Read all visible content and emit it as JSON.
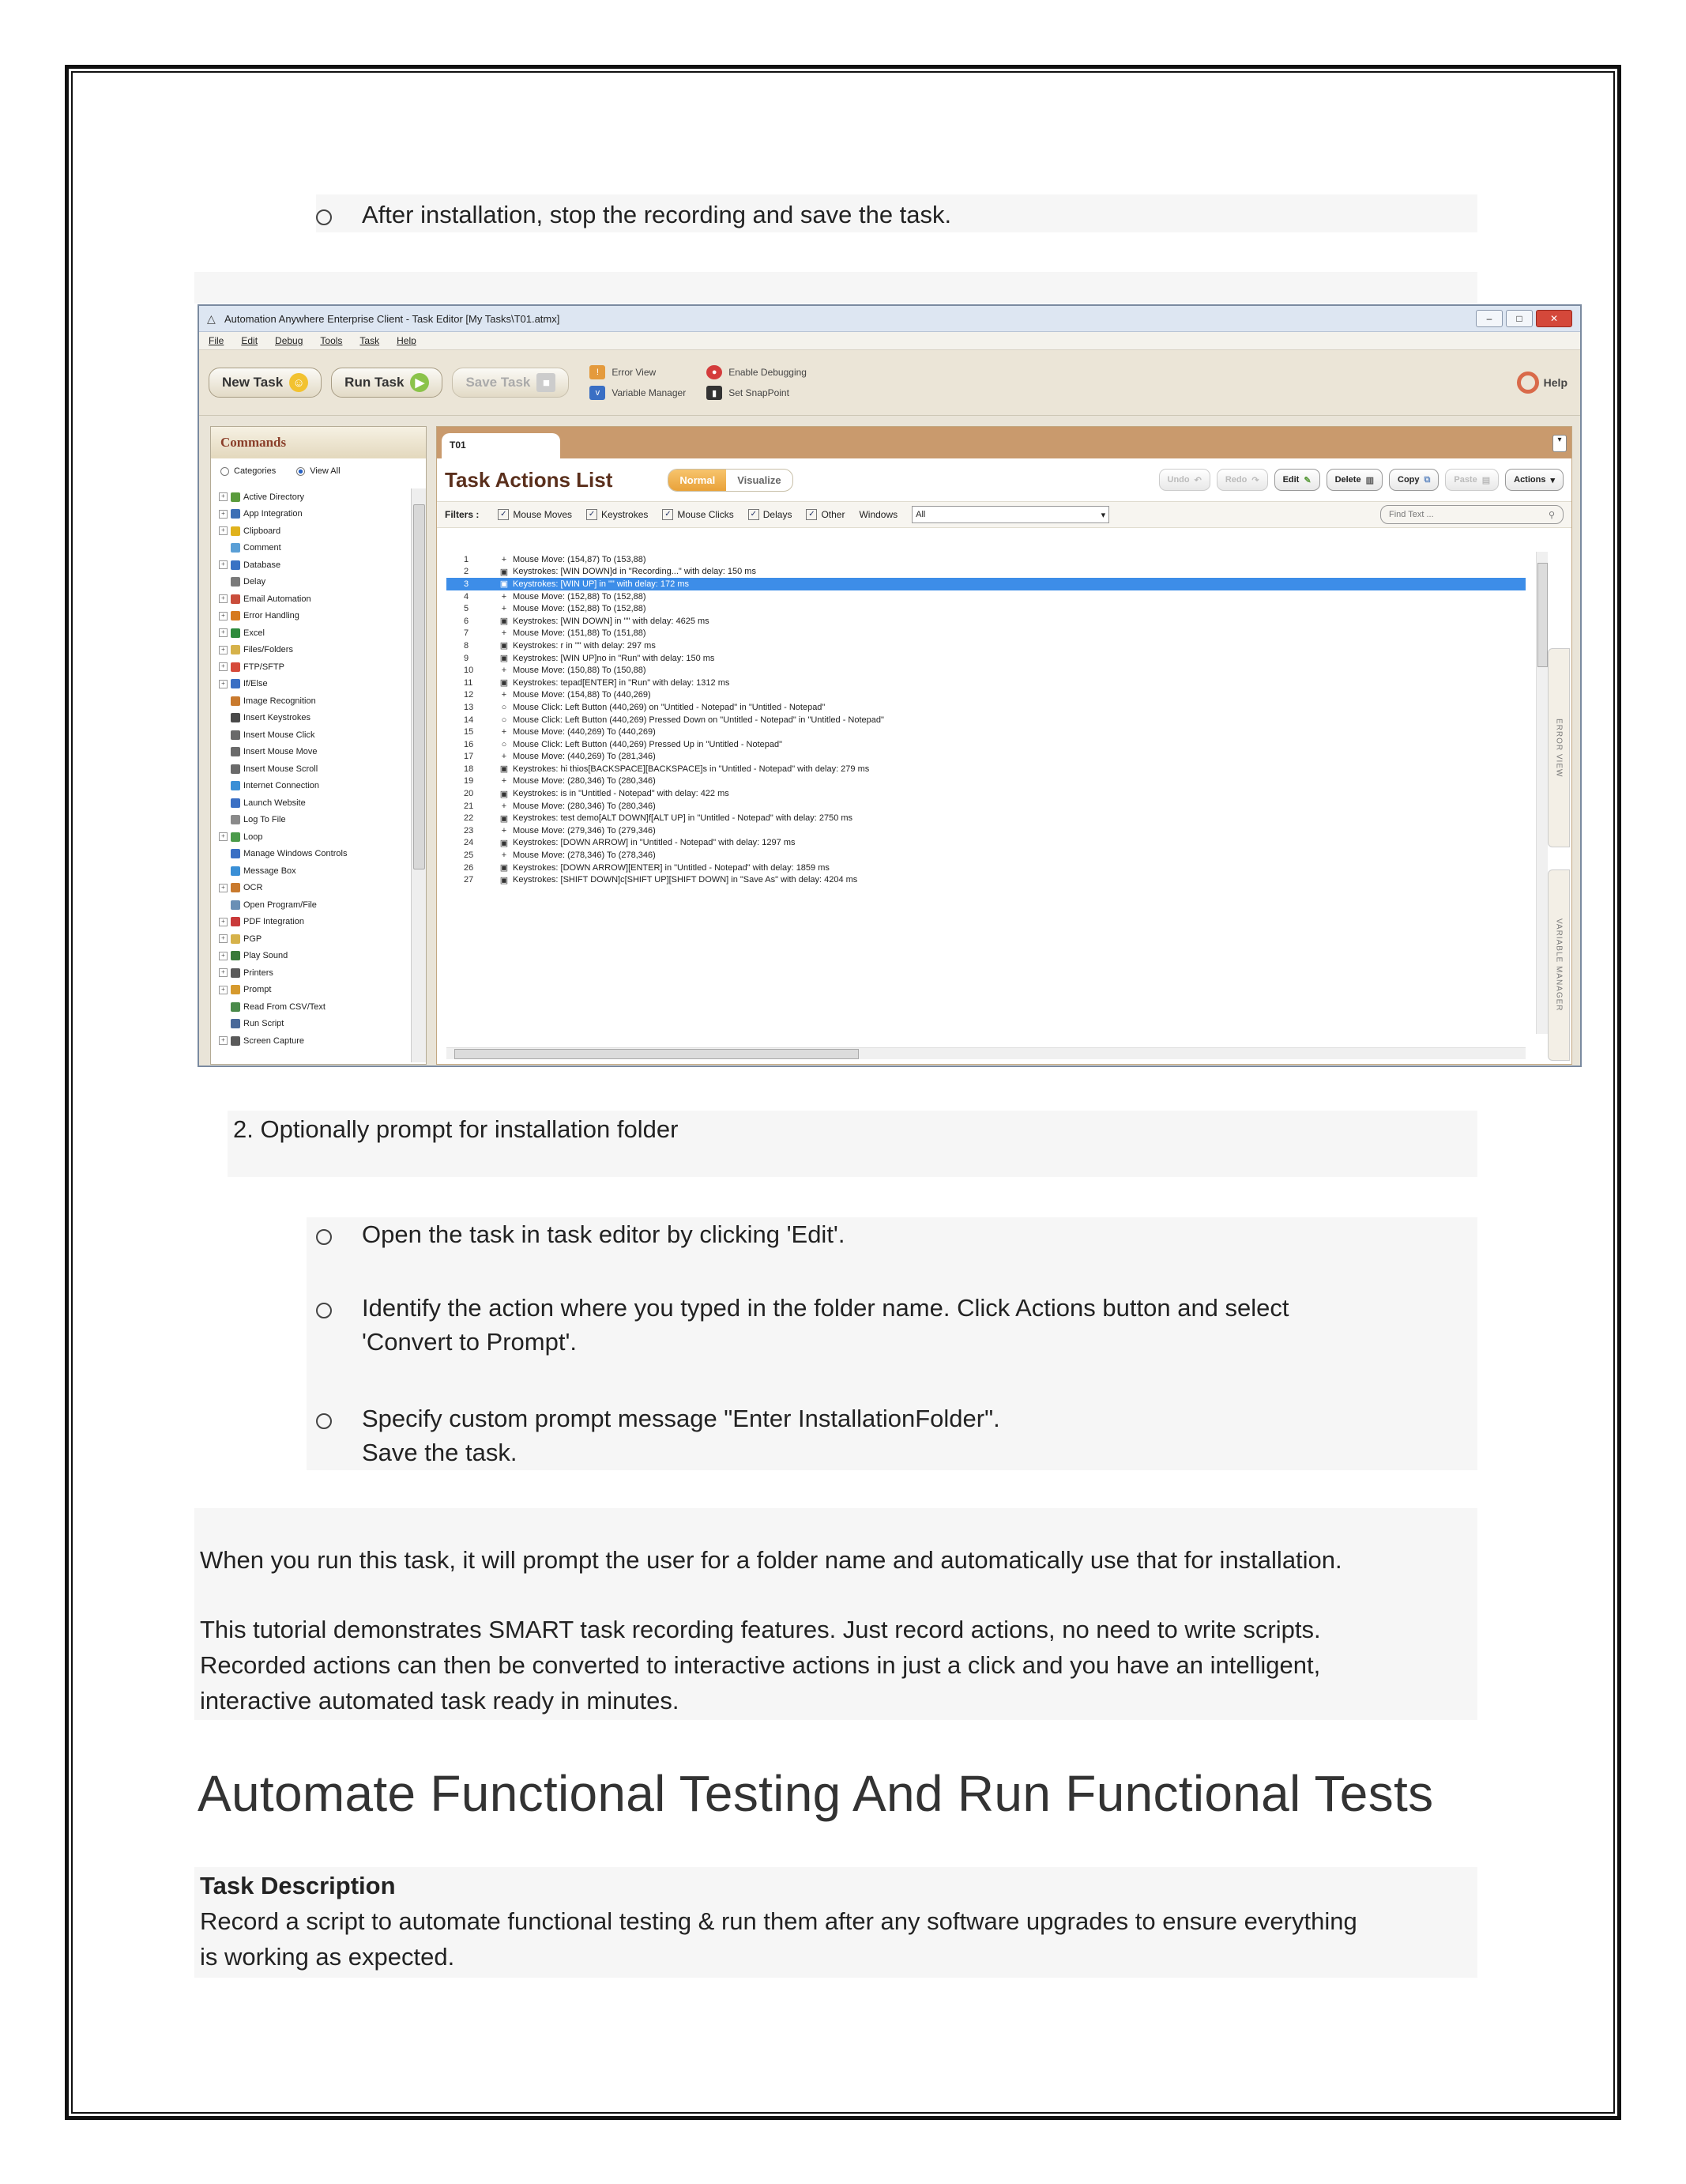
{
  "doc": {
    "bullet_top": "After installation, stop the recording and save the task.",
    "step2": "2.  Optionally prompt for installation folder",
    "sub_bullets": [
      "Open the task in task editor by clicking 'Edit'.",
      "Identify the action where you typed in the folder name. Click Actions button and select",
      "'Convert to Prompt'.",
      "Specify custom prompt message \"Enter InstallationFolder\".",
      "Save the task."
    ],
    "para1": "When you run this task, it will prompt the user for a folder name and automatically use that for installation.",
    "para2_lines": [
      "This tutorial demonstrates SMART task recording features. Just record actions, no need to write scripts.",
      "Recorded actions can then be converted to interactive actions in just a click and you have an intelligent,",
      "interactive automated task ready in minutes."
    ],
    "heading": "Automate Functional Testing And Run Functional Tests",
    "task_desc_label": "Task Description",
    "task_desc_lines": [
      "Record a script to automate functional testing & run them after any software upgrades to ensure everything",
      "is working as expected."
    ]
  },
  "app": {
    "window_title": "Automation Anywhere Enterprise Client - Task Editor [My Tasks\\T01.atmx]",
    "menu": [
      "File",
      "Edit",
      "Debug",
      "Tools",
      "Task",
      "Help"
    ],
    "toolbar": {
      "new_task": "New Task",
      "run_task": "Run Task",
      "save_task": "Save Task",
      "error_view": "Error View",
      "variable_manager": "Variable Manager",
      "enable_debugging": "Enable Debugging",
      "set_snappoint": "Set SnapPoint",
      "help": "Help"
    },
    "commands": {
      "title": "Commands",
      "radio_categories": "Categories",
      "radio_view_all": "View All",
      "items": [
        {
          "label": "Active Directory",
          "color": "#5a9b3c",
          "exp": true
        },
        {
          "label": "App Integration",
          "color": "#3c6fb5",
          "exp": true
        },
        {
          "label": "Clipboard",
          "color": "#e0b21c",
          "exp": true
        },
        {
          "label": "Comment",
          "color": "#5a9fd6",
          "exp": false
        },
        {
          "label": "Database",
          "color": "#3a72c4",
          "exp": true
        },
        {
          "label": "Delay",
          "color": "#7a7a7a",
          "exp": false
        },
        {
          "label": "Email Automation",
          "color": "#c94d3b",
          "exp": true
        },
        {
          "label": "Error Handling",
          "color": "#d67a1e",
          "exp": true
        },
        {
          "label": "Excel",
          "color": "#2e8b3c",
          "exp": true
        },
        {
          "label": "Files/Folders",
          "color": "#d6b24a",
          "exp": true
        },
        {
          "label": "FTP/SFTP",
          "color": "#d64a3a",
          "exp": true
        },
        {
          "label": "If/Else",
          "color": "#3a6fc4",
          "exp": true
        },
        {
          "label": "Image Recognition",
          "color": "#c97a2e",
          "exp": false
        },
        {
          "label": "Insert Keystrokes",
          "color": "#4a4a4a",
          "exp": false
        },
        {
          "label": "Insert Mouse Click",
          "color": "#6a6a6a",
          "exp": false
        },
        {
          "label": "Insert Mouse Move",
          "color": "#6a6a6a",
          "exp": false
        },
        {
          "label": "Insert Mouse Scroll",
          "color": "#6a6a6a",
          "exp": false
        },
        {
          "label": "Internet Connection",
          "color": "#3a8fd6",
          "exp": false
        },
        {
          "label": "Launch Website",
          "color": "#3a6fc4",
          "exp": false
        },
        {
          "label": "Log To File",
          "color": "#8a8a8a",
          "exp": false
        },
        {
          "label": "Loop",
          "color": "#4a9a4a",
          "exp": true
        },
        {
          "label": "Manage Windows Controls",
          "color": "#3a6fc4",
          "exp": false
        },
        {
          "label": "Message Box",
          "color": "#3a8fd6",
          "exp": false
        },
        {
          "label": "OCR",
          "color": "#c97a2e",
          "exp": true
        },
        {
          "label": "Open Program/File",
          "color": "#6a8fb5",
          "exp": false
        },
        {
          "label": "PDF Integration",
          "color": "#c93a3a",
          "exp": true
        },
        {
          "label": "PGP",
          "color": "#d6b24a",
          "exp": true
        },
        {
          "label": "Play Sound",
          "color": "#3a7a3a",
          "exp": true
        },
        {
          "label": "Printers",
          "color": "#5a5a5a",
          "exp": true
        },
        {
          "label": "Prompt",
          "color": "#d69a2e",
          "exp": true
        },
        {
          "label": "Read From CSV/Text",
          "color": "#4a8a4a",
          "exp": false
        },
        {
          "label": "Run Script",
          "color": "#4a6a9a",
          "exp": false
        },
        {
          "label": "Screen Capture",
          "color": "#5a5a5a",
          "exp": true
        }
      ]
    },
    "editor": {
      "tab": "T01",
      "title": "Task Actions List",
      "mode_normal": "Normal",
      "mode_visualize": "Visualize",
      "buttons": [
        "Undo",
        "Redo",
        "Edit",
        "Delete",
        "Copy",
        "Paste",
        "Actions"
      ],
      "filters_label": "Filters :",
      "filters": [
        "Mouse Moves",
        "Keystrokes",
        "Mouse Clicks",
        "Delays",
        "Other"
      ],
      "windows_label": "Windows",
      "windows_value": "All",
      "find_placeholder": "Find Text ...",
      "side_error": "ERROR VIEW",
      "side_variable": "VARIABLE MANAGER",
      "actions": [
        {
          "n": "1",
          "t": "Mouse Move: (154,87) To (153,88)",
          "k": "m"
        },
        {
          "n": "2",
          "t": "Keystrokes: [WIN DOWN]d in \"Recording...\" with delay: 150 ms",
          "k": "k"
        },
        {
          "n": "3",
          "t": "Keystrokes: [WIN UP] in \"\" with delay: 172 ms",
          "k": "k",
          "sel": true
        },
        {
          "n": "4",
          "t": "Mouse Move: (152,88) To (152,88)",
          "k": "m"
        },
        {
          "n": "5",
          "t": "Mouse Move: (152,88) To (152,88)",
          "k": "m"
        },
        {
          "n": "6",
          "t": "Keystrokes: [WIN DOWN] in \"\" with delay: 4625 ms",
          "k": "k"
        },
        {
          "n": "7",
          "t": "Mouse Move: (151,88) To (151,88)",
          "k": "m"
        },
        {
          "n": "8",
          "t": "Keystrokes: r in \"\" with delay: 297 ms",
          "k": "k"
        },
        {
          "n": "9",
          "t": "Keystrokes: [WIN UP]no in \"Run\" with delay: 150 ms",
          "k": "k"
        },
        {
          "n": "10",
          "t": "Mouse Move: (150,88) To (150,88)",
          "k": "m"
        },
        {
          "n": "11",
          "t": "Keystrokes: tepad[ENTER] in \"Run\" with delay: 1312 ms",
          "k": "k"
        },
        {
          "n": "12",
          "t": "Mouse Move: (154,88) To (440,269)",
          "k": "m"
        },
        {
          "n": "13",
          "t": "Mouse Click: Left Button (440,269)  on \"Untitled - Notepad\" in \"Untitled - Notepad\"",
          "k": "c"
        },
        {
          "n": "14",
          "t": "Mouse Click: Left Button (440,269) Pressed Down on \"Untitled - Notepad\" in \"Untitled - Notepad\"",
          "k": "c"
        },
        {
          "n": "15",
          "t": "Mouse Move: (440,269) To (440,269)",
          "k": "m"
        },
        {
          "n": "16",
          "t": "Mouse Click: Left Button (440,269) Pressed Up  in \"Untitled - Notepad\"",
          "k": "c"
        },
        {
          "n": "17",
          "t": "Mouse Move: (440,269) To (281,346)",
          "k": "m"
        },
        {
          "n": "18",
          "t": "Keystrokes: hi thios[BACKSPACE][BACKSPACE]s  in \"Untitled - Notepad\" with delay: 279 ms",
          "k": "k"
        },
        {
          "n": "19",
          "t": "Mouse Move: (280,346) To (280,346)",
          "k": "m"
        },
        {
          "n": "20",
          "t": "Keystrokes: is  in \"Untitled - Notepad\" with delay: 422 ms",
          "k": "k"
        },
        {
          "n": "21",
          "t": "Mouse Move: (280,346) To (280,346)",
          "k": "m"
        },
        {
          "n": "22",
          "t": "Keystrokes: test demo[ALT DOWN]f[ALT UP] in \"Untitled - Notepad\" with delay: 2750 ms",
          "k": "k"
        },
        {
          "n": "23",
          "t": "Mouse Move: (279,346) To (279,346)",
          "k": "m"
        },
        {
          "n": "24",
          "t": "Keystrokes: [DOWN ARROW] in \"Untitled - Notepad\" with delay: 1297 ms",
          "k": "k"
        },
        {
          "n": "25",
          "t": "Mouse Move: (278,346) To (278,346)",
          "k": "m"
        },
        {
          "n": "26",
          "t": "Keystrokes: [DOWN ARROW][ENTER] in \"Untitled - Notepad\" with delay: 1859 ms",
          "k": "k"
        },
        {
          "n": "27",
          "t": "Keystrokes: [SHIFT DOWN]c[SHIFT UP][SHIFT DOWN] in \"Save As\" with delay: 4204 ms",
          "k": "k"
        }
      ]
    }
  }
}
